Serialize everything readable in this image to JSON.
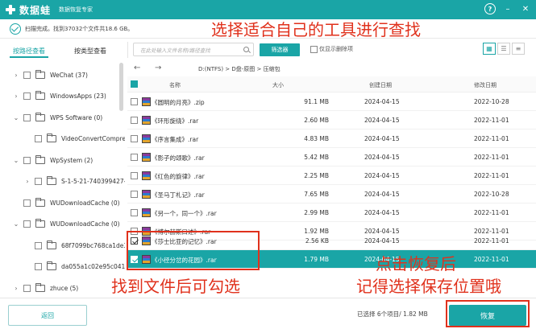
{
  "titlebar": {
    "app_name": "数据蛙",
    "subtitle": "数据恢复专家",
    "help": "?",
    "minimize": "–",
    "close": "✕"
  },
  "scan": {
    "status_text": "扫描完成。找到37032个文件共18.6 GB。"
  },
  "tabs": [
    {
      "label": "按路径查看"
    },
    {
      "label": "按类型查看"
    }
  ],
  "search": {
    "placeholder": "在此处输入文件名称/路径查找"
  },
  "filter": {
    "label": "筛选器",
    "show_deleted_label": "仅显示删除项"
  },
  "path": {
    "text": "D:(NTFS) > D盘-原图 > 压缩包"
  },
  "sidebar": {
    "items": [
      {
        "label": "WeChat (37)",
        "depth": 0,
        "caret": "›"
      },
      {
        "label": "WindowsApps (23)",
        "depth": 0,
        "caret": "›"
      },
      {
        "label": "WPS Software (0)",
        "depth": 0,
        "caret": "⌄"
      },
      {
        "label": "VideoConvertCompress",
        "depth": 1,
        "caret": ""
      },
      {
        "label": "WpSystem (2)",
        "depth": 0,
        "caret": "⌄"
      },
      {
        "label": "S-1-5-21-740399427-3",
        "depth": 1,
        "caret": "›"
      },
      {
        "label": "WUDownloadCache (0)",
        "depth": 0,
        "caret": ""
      },
      {
        "label": "WUDownloadCache (0)",
        "depth": 0,
        "caret": "⌄"
      },
      {
        "label": "68f7099bc768ca1de3e",
        "depth": 1,
        "caret": ""
      },
      {
        "label": "da055a1c02e95c041ac",
        "depth": 1,
        "caret": ""
      },
      {
        "label": "zhuce (5)",
        "depth": 0,
        "caret": "›"
      }
    ]
  },
  "table": {
    "columns": {
      "name": "名称",
      "size": "大小",
      "created": "创建日期",
      "modified": "修改日期"
    },
    "rows": [
      {
        "name": "《圆明的月亮》.zip",
        "size": "91.1 MB",
        "created": "2024-04-15",
        "modified": "2022-10-28",
        "checked": false
      },
      {
        "name": "《环形旋绕》.rar",
        "size": "2.60 MB",
        "created": "2024-04-15",
        "modified": "2022-11-01",
        "checked": false
      },
      {
        "name": "《序言集成》.rar",
        "size": "4.83 MB",
        "created": "2024-04-15",
        "modified": "2022-11-01",
        "checked": false
      },
      {
        "name": "《影子的颂歌》.rar",
        "size": "5.42 MB",
        "created": "2024-04-15",
        "modified": "2022-11-01",
        "checked": false
      },
      {
        "name": "《红色的旋律》.rar",
        "size": "2.25 MB",
        "created": "2024-04-15",
        "modified": "2022-11-01",
        "checked": false
      },
      {
        "name": "《圣马丁札记》.rar",
        "size": "7.65 MB",
        "created": "2024-04-15",
        "modified": "2022-10-28",
        "checked": false
      },
      {
        "name": "《另一个，同一个》.rar",
        "size": "2.99 MB",
        "created": "2024-04-15",
        "modified": "2022-11-01",
        "checked": false
      },
      {
        "name": "《博尔赫斯口述》.rar",
        "size": "1.92 MB",
        "created": "2024-04-15",
        "modified": "2022-11-01",
        "checked": false
      },
      {
        "name": "《莎士比亚的记忆》.rar",
        "size": "2.56 KB",
        "created": "2024-04-15",
        "modified": "2022-11-01",
        "checked": true
      },
      {
        "name": "《小径分岔的花园》.rar",
        "size": "1.79 MB",
        "created": "2024-04-15",
        "modified": "2022-11-01",
        "checked": true,
        "selected": true
      }
    ]
  },
  "footer": {
    "back_label": "返回",
    "status_text": "已选择 6个项目/ 1.82 MB",
    "recover_label": "恢复"
  },
  "annotations": {
    "top": "选择适合自己的工具进行查找",
    "bottom_left": "找到文件后可勾选",
    "bottom_right_1": "点击恢复后",
    "bottom_right_2": "记得选择保存位置哦"
  },
  "colors": {
    "accent": "#1aa5a6",
    "annotation": "#e0311c"
  },
  "icons": {
    "logo": "logo-cross-icon",
    "help": "help-icon",
    "scan_done": "check-circle-icon",
    "search": "search-icon",
    "folder": "folder-icon",
    "archive": "winrar-archive-icon"
  }
}
